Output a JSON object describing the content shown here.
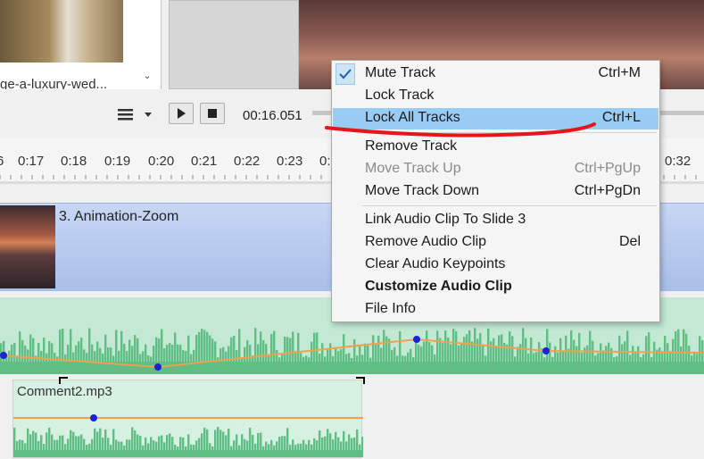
{
  "thumbnail": {
    "label": "ge-a-luxury-wed..."
  },
  "toolbar": {
    "time": "00:16.051"
  },
  "ruler": {
    "ticks": [
      "6",
      "0:17",
      "0:18",
      "0:19",
      "0:20",
      "0:21",
      "0:22",
      "0:23",
      "0:",
      "0:32"
    ]
  },
  "tracks": {
    "video_label": "3. Animation-Zoom",
    "audio_clip_label": "Comment2.mp3"
  },
  "context_menu": {
    "items": [
      {
        "label": "Mute Track",
        "shortcut": "Ctrl+M"
      },
      {
        "label": "Lock Track",
        "shortcut": ""
      },
      {
        "label": "Lock All Tracks",
        "shortcut": "Ctrl+L"
      },
      {
        "label": "Remove Track",
        "shortcut": ""
      },
      {
        "label": "Move Track Up",
        "shortcut": "Ctrl+PgUp"
      },
      {
        "label": "Move Track Down",
        "shortcut": "Ctrl+PgDn"
      },
      {
        "label": "Link Audio Clip To Slide 3",
        "shortcut": ""
      },
      {
        "label": "Remove Audio Clip",
        "shortcut": "Del"
      },
      {
        "label": "Clear Audio Keypoints",
        "shortcut": ""
      },
      {
        "label": "Customize Audio Clip",
        "shortcut": ""
      },
      {
        "label": "File Info",
        "shortcut": ""
      }
    ]
  },
  "colors": {
    "highlight": "#99ccf5",
    "annotation_stroke": "#e8141c",
    "waveform": "#5fbe84",
    "keypoint": "#1a24d6",
    "volume_line": "#f0a050"
  }
}
